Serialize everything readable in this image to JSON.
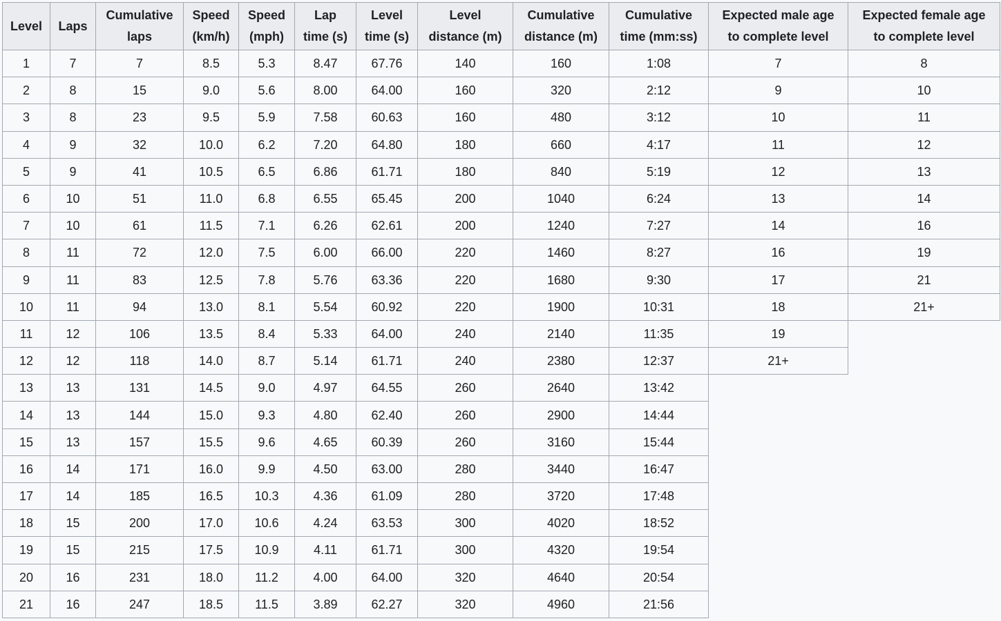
{
  "table": {
    "headers": [
      "Level",
      "Laps",
      "Cumulative laps",
      "Speed (km/h)",
      "Speed (mph)",
      "Lap time (s)",
      "Level time (s)",
      "Level distance (m)",
      "Cumulative distance (m)",
      "Cumulative time (mm:ss)",
      "Expected male age to complete level",
      "Expected female age to complete level"
    ],
    "rows": [
      [
        "1",
        "7",
        "7",
        "8.5",
        "5.3",
        "8.47",
        "67.76",
        "140",
        "160",
        "1:08",
        "7",
        "8"
      ],
      [
        "2",
        "8",
        "15",
        "9.0",
        "5.6",
        "8.00",
        "64.00",
        "160",
        "320",
        "2:12",
        "9",
        "10"
      ],
      [
        "3",
        "8",
        "23",
        "9.5",
        "5.9",
        "7.58",
        "60.63",
        "160",
        "480",
        "3:12",
        "10",
        "11"
      ],
      [
        "4",
        "9",
        "32",
        "10.0",
        "6.2",
        "7.20",
        "64.80",
        "180",
        "660",
        "4:17",
        "11",
        "12"
      ],
      [
        "5",
        "9",
        "41",
        "10.5",
        "6.5",
        "6.86",
        "61.71",
        "180",
        "840",
        "5:19",
        "12",
        "13"
      ],
      [
        "6",
        "10",
        "51",
        "11.0",
        "6.8",
        "6.55",
        "65.45",
        "200",
        "1040",
        "6:24",
        "13",
        "14"
      ],
      [
        "7",
        "10",
        "61",
        "11.5",
        "7.1",
        "6.26",
        "62.61",
        "200",
        "1240",
        "7:27",
        "14",
        "16"
      ],
      [
        "8",
        "11",
        "72",
        "12.0",
        "7.5",
        "6.00",
        "66.00",
        "220",
        "1460",
        "8:27",
        "16",
        "19"
      ],
      [
        "9",
        "11",
        "83",
        "12.5",
        "7.8",
        "5.76",
        "63.36",
        "220",
        "1680",
        "9:30",
        "17",
        "21"
      ],
      [
        "10",
        "11",
        "94",
        "13.0",
        "8.1",
        "5.54",
        "60.92",
        "220",
        "1900",
        "10:31",
        "18",
        "21+"
      ],
      [
        "11",
        "12",
        "106",
        "13.5",
        "8.4",
        "5.33",
        "64.00",
        "240",
        "2140",
        "11:35",
        "19",
        null
      ],
      [
        "12",
        "12",
        "118",
        "14.0",
        "8.7",
        "5.14",
        "61.71",
        "240",
        "2380",
        "12:37",
        "21+",
        null
      ],
      [
        "13",
        "13",
        "131",
        "14.5",
        "9.0",
        "4.97",
        "64.55",
        "260",
        "2640",
        "13:42",
        null,
        null
      ],
      [
        "14",
        "13",
        "144",
        "15.0",
        "9.3",
        "4.80",
        "62.40",
        "260",
        "2900",
        "14:44",
        null,
        null
      ],
      [
        "15",
        "13",
        "157",
        "15.5",
        "9.6",
        "4.65",
        "60.39",
        "260",
        "3160",
        "15:44",
        null,
        null
      ],
      [
        "16",
        "14",
        "171",
        "16.0",
        "9.9",
        "4.50",
        "63.00",
        "280",
        "3440",
        "16:47",
        null,
        null
      ],
      [
        "17",
        "14",
        "185",
        "16.5",
        "10.3",
        "4.36",
        "61.09",
        "280",
        "3720",
        "17:48",
        null,
        null
      ],
      [
        "18",
        "15",
        "200",
        "17.0",
        "10.6",
        "4.24",
        "63.53",
        "300",
        "4020",
        "18:52",
        null,
        null
      ],
      [
        "19",
        "15",
        "215",
        "17.5",
        "10.9",
        "4.11",
        "61.71",
        "300",
        "4320",
        "19:54",
        null,
        null
      ],
      [
        "20",
        "16",
        "231",
        "18.0",
        "11.2",
        "4.00",
        "64.00",
        "320",
        "4640",
        "20:54",
        null,
        null
      ],
      [
        "21",
        "16",
        "247",
        "18.5",
        "11.5",
        "3.89",
        "62.27",
        "320",
        "4960",
        "21:56",
        null,
        null
      ]
    ]
  }
}
